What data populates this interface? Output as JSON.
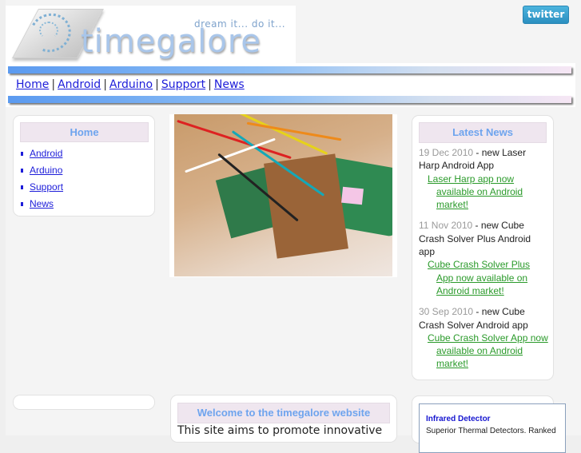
{
  "header": {
    "logo_text": "timegalore",
    "tagline": "dream it... do it...",
    "twitter_label": "twitter"
  },
  "nav": {
    "items": [
      "Home",
      "Android",
      "Arduino",
      "Support",
      "News"
    ],
    "separator": "|"
  },
  "sidebar": {
    "title": "Home",
    "items": [
      "Android",
      "Arduino",
      "Support",
      "News"
    ]
  },
  "photo": {
    "alt": "circuit board with wires"
  },
  "latest_news": {
    "title": "Latest News",
    "items": [
      {
        "date": "19 Dec 2010",
        "headline": " - new Laser Harp Android App",
        "link_first": "Laser Harp app now",
        "link_rest": "available on Android market!"
      },
      {
        "date": "11 Nov 2010",
        "headline": " - new Cube Crash Solver Plus Android app",
        "link_first": "Cube Crash Solver Plus",
        "link_rest": "App now available on Android market!"
      },
      {
        "date": "30 Sep 2010",
        "headline": " - new Cube Crash Solver Android app",
        "link_first": "Cube Crash Solver App now",
        "link_rest": "available on Android market!"
      }
    ]
  },
  "welcome": {
    "title": "Welcome to the timegalore website",
    "text": "This site aims to promote innovative"
  },
  "ad": {
    "title": "Infrared Detector",
    "text": "Superior Thermal Detectors. Ranked"
  },
  "colors": {
    "link": "#1d1dd9",
    "news_link": "#2a9a2a",
    "panel_title_text": "#6ea4ee",
    "panel_title_bg": "#efe6ef",
    "twitter": "#2b8fc0"
  }
}
